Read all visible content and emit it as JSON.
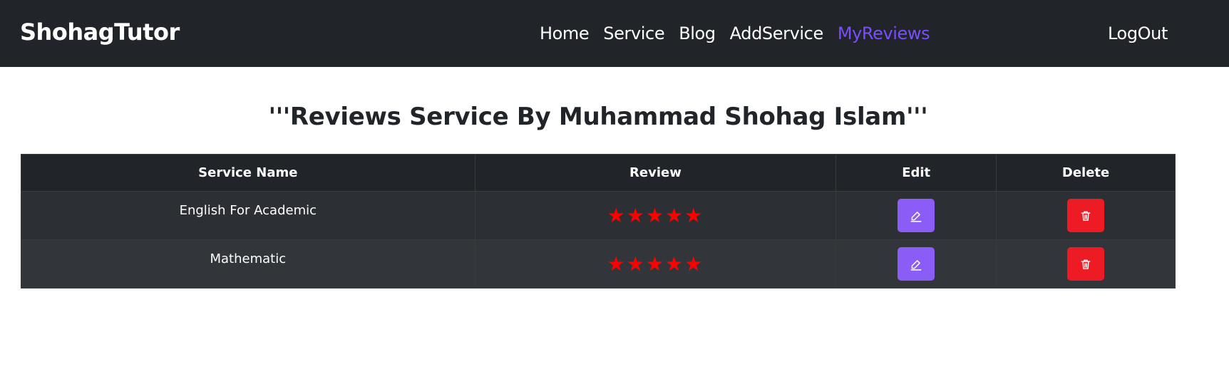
{
  "colors": {
    "navbar_bg": "#212529",
    "accent": "#7c4dff",
    "star": "#ff0000",
    "edit_button": "#8b5cf6",
    "delete_button": "#ed1c24"
  },
  "navbar": {
    "brand": "ShohagTutor",
    "links": [
      {
        "label": "Home",
        "active": false
      },
      {
        "label": "Service",
        "active": false
      },
      {
        "label": "Blog",
        "active": false
      },
      {
        "label": "AddService",
        "active": false
      },
      {
        "label": "MyReviews",
        "active": true
      }
    ],
    "logout": "LogOut"
  },
  "page": {
    "title": "'''Reviews Service By Muhammad Shohag Islam'''"
  },
  "table": {
    "headers": [
      "Service Name",
      "Review",
      "Edit",
      "Delete"
    ],
    "rows": [
      {
        "service_name": "English For Academic",
        "rating": 5,
        "edit_icon": "pencil-icon",
        "delete_icon": "trash-icon"
      },
      {
        "service_name": "Mathematic",
        "rating": 5,
        "edit_icon": "pencil-icon",
        "delete_icon": "trash-icon"
      }
    ]
  }
}
